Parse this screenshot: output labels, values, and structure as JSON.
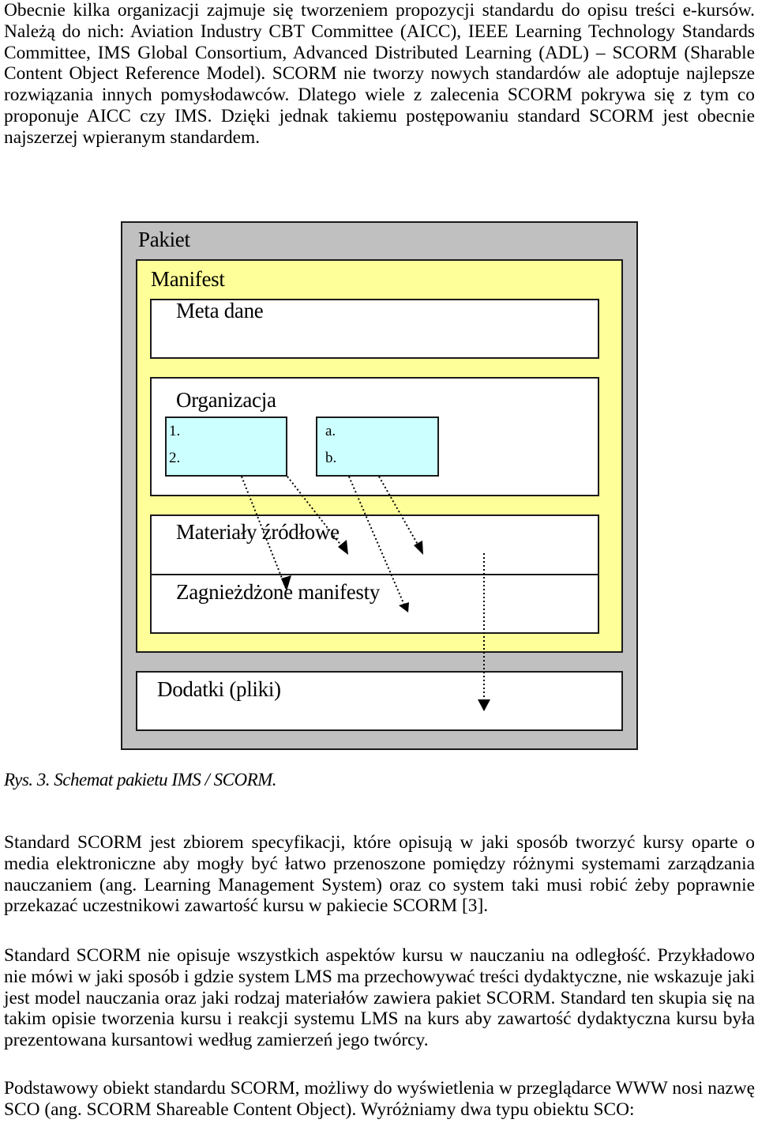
{
  "paragraphs": {
    "intro": "Obecnie kilka organizacji zajmuje się tworzeniem propozycji standardu do opisu treści e-kursów. Należą do nich: Aviation Industry CBT Committee (AICC), IEEE Learning Technology Standards Committee, IMS Global Consortium, Advanced Distributed Learning (ADL) – SCORM (Sharable Content Object Reference Model). SCORM nie tworzy nowych standardów ale adoptuje najlepsze rozwiązania innych pomysłodawców. Dlatego wiele z zalecenia SCORM pokrywa się z tym co proponuje AICC czy IMS. Dzięki jednak takiemu postępowaniu standard SCORM jest obecnie najszerzej wpieranym standardem.",
    "scorm_definition": "Standard SCORM jest zbiorem specyfikacji, które opisują w jaki sposób tworzyć kursy oparte o media elektroniczne aby mogły być łatwo przenoszone pomiędzy różnymi systemami zarządzania nauczaniem (ang. Learning Management System) oraz co system taki musi robić żeby poprawnie przekazać uczestnikowi zawartość kursu w pakiecie SCORM [3].",
    "scorm_scope": "Standard SCORM nie opisuje wszystkich aspektów kursu w nauczaniu na odległość. Przykładowo nie mówi w jaki sposób i gdzie system LMS ma przechowywać treści dydaktyczne, nie wskazuje jaki jest model nauczania oraz jaki rodzaj materiałów zawiera pakiet SCORM. Standard ten skupia się na takim opisie tworzenia kursu i reakcji systemu LMS na kurs aby zawartość dydaktyczna kursu była prezentowana kursantowi według zamierzeń jego twórcy.",
    "sco_intro": "Podstawowy obiekt standardu SCORM, możliwy do wyświetlenia w przeglądarce WWW nosi nazwę SCO (ang. SCORM Shareable Content Object). Wyróżniamy dwa typu obiektu SCO:"
  },
  "figure": {
    "package_label": "Pakiet",
    "manifest_label": "Manifest",
    "metadata_label": "Meta dane",
    "organization_label": "Organizacja",
    "org_list_1": [
      "1.",
      "2."
    ],
    "org_list_2": [
      "a.",
      "b."
    ],
    "resources_label": "Materiały źródłowe",
    "nested_manifests_label": "Zagnieżdżone manifesty",
    "files_label": "Dodatki (pliki)",
    "caption": "Rys. 3. Schemat pakietu IMS / SCORM.",
    "colors": {
      "package": "#c0c0c0",
      "manifest": "#ffff99",
      "organization_items": "#ccffff",
      "inner_boxes": "#ffffff"
    }
  }
}
